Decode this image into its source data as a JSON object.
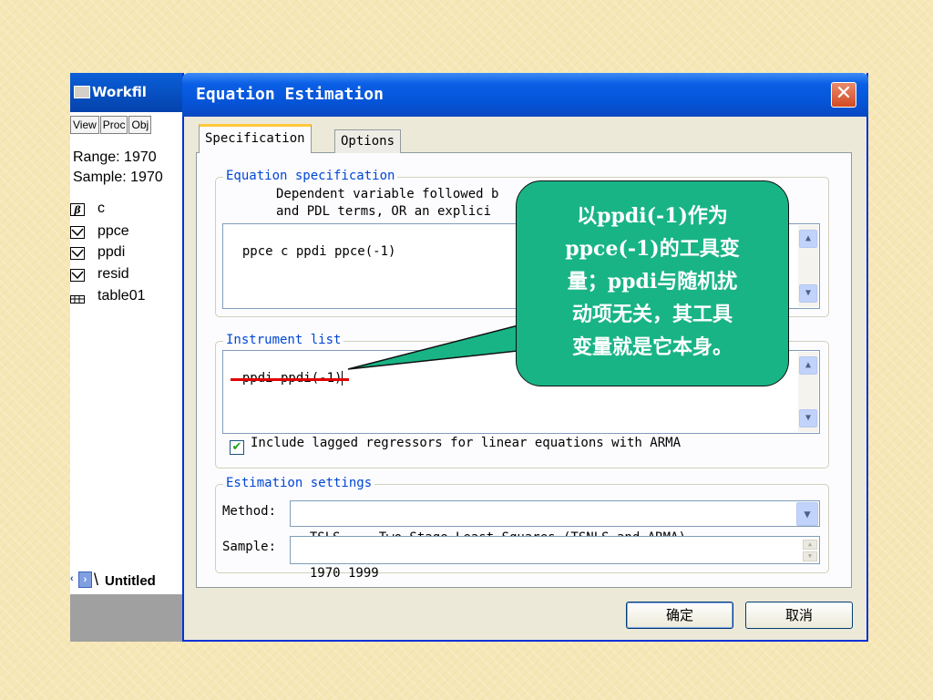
{
  "workfile": {
    "title": "Workfil",
    "toolbar": [
      "View",
      "Proc",
      "Obj"
    ],
    "range_line": "Range:  1970",
    "sample_line": "Sample: 1970",
    "objects": [
      {
        "name": "c",
        "icon": "coef-icon"
      },
      {
        "name": "ppce",
        "icon": "series-icon"
      },
      {
        "name": "ppdi",
        "icon": "series-icon"
      },
      {
        "name": "resid",
        "icon": "series-icon"
      },
      {
        "name": "table01",
        "icon": "table-icon"
      }
    ],
    "tab_label": "Untitled"
  },
  "dialog": {
    "title": "Equation Estimation",
    "close_glyph": "✕",
    "tabs": [
      "Specification",
      "Options"
    ],
    "equation_spec": {
      "label": "Equation specification",
      "help_line1": "Dependent variable followed b",
      "help_line2": "and PDL terms, OR an explici",
      "value": "ppce c ppdi ppce(-1)"
    },
    "instrument_list": {
      "label": "Instrument list",
      "value": "ppdi ppdi(-1)",
      "checkbox_checked": true,
      "checkbox_label": "Include lagged regressors for linear equations with ARMA"
    },
    "estimation_settings": {
      "label": "Estimation settings",
      "method_label": "Method:",
      "method_value": "TSLS  -  Two-Stage Least Squares (TSNLS and ARMA)",
      "sample_label": "Sample:",
      "sample_value": "1970 1999"
    },
    "buttons": {
      "ok": "确定",
      "cancel": "取消"
    }
  },
  "callout": {
    "lines": [
      "以ppdi(-1)作为",
      "ppce(-1)的工具变",
      "量；ppdi与随机扰",
      "动项无关，其工具",
      "变量就是它本身。"
    ]
  },
  "colors": {
    "titlebar": "#0553d6",
    "group_label": "#0046d5",
    "callout_fill": "#19b486",
    "underline": "#e00000"
  }
}
